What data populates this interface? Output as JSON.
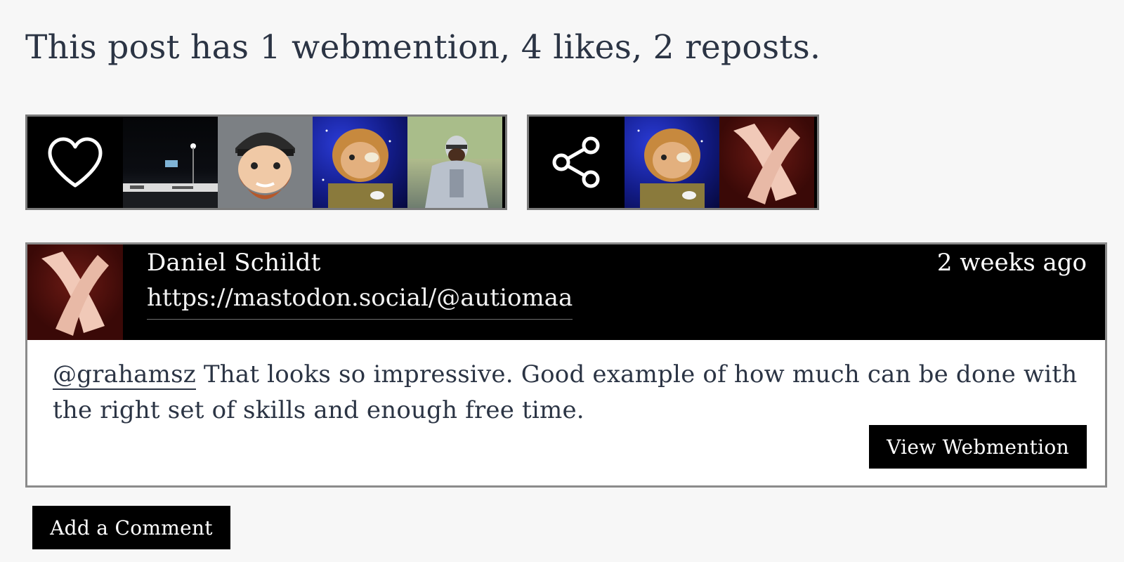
{
  "summary": "This post has 1 webmention, 4 likes, 2 reposts.",
  "likes": {
    "icon": "heart-icon",
    "avatars": [
      "night-scene",
      "bearded-cartoon",
      "space-cartoon",
      "armored-figure"
    ]
  },
  "reposts": {
    "icon": "share-icon",
    "avatars": [
      "space-cartoon",
      "hands"
    ]
  },
  "comment": {
    "author_name": "Daniel Schildt",
    "author_url": "https://mastodon.social/@autiomaa",
    "time_ago": "2 weeks ago",
    "mention": "@grahamsz",
    "text": " That looks so impressive. Good example of how much can be done with the right set of skills and enough free time.",
    "view_label": "View Webmention"
  },
  "add_comment_label": "Add a Comment",
  "colors": {
    "page_bg": "#f7f7f7",
    "text": "#2b3444",
    "strip_bg": "#000000",
    "border": "#7b7b7b"
  }
}
